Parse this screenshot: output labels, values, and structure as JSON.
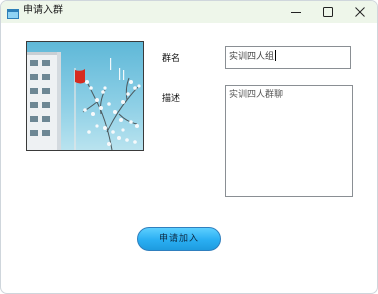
{
  "window": {
    "title": "申请入群"
  },
  "form": {
    "name_label": "群名",
    "name_value": "实训四人组",
    "desc_label": "描述",
    "desc_value": "实训四人群聊"
  },
  "actions": {
    "apply_label": "申请加入"
  },
  "icons": {
    "app": "app-window-icon",
    "minimize": "minimize-icon",
    "maximize": "maximize-icon",
    "close": "close-icon"
  },
  "colors": {
    "titlebar": "#eef6ea",
    "button": "#2aaef2",
    "button_border": "#2f7fbe"
  }
}
